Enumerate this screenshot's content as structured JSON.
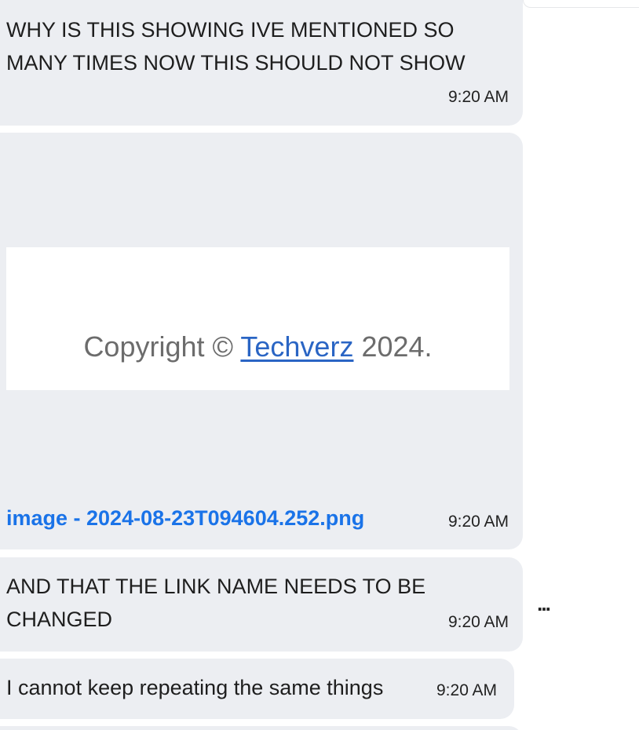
{
  "messages": [
    {
      "text": "WHY IS THIS SHOWING IVE MENTIONED SO MANY TIMES NOW THIS SHOULD NOT SHOW",
      "time": "9:20 AM"
    },
    {
      "attachment": {
        "preview_text_before": "Copyright © ",
        "preview_link_text": "Techverz",
        "preview_text_after": " 2024.",
        "file_name": "image - 2024-08-23T094604.252.png"
      },
      "time": "9:20 AM"
    },
    {
      "text": "AND THAT THE LINK NAME NEEDS TO BE CHANGED",
      "time": "9:20 AM"
    },
    {
      "text": "I cannot keep repeating the same things",
      "time": "9:20 AM"
    }
  ],
  "actions": {
    "more_label": "..."
  },
  "colors": {
    "bubble_bg": "#eceef2",
    "link_blue": "#1a73e8",
    "preview_link": "#2a65c4"
  },
  "icons": {
    "more": "more-options-icon"
  }
}
